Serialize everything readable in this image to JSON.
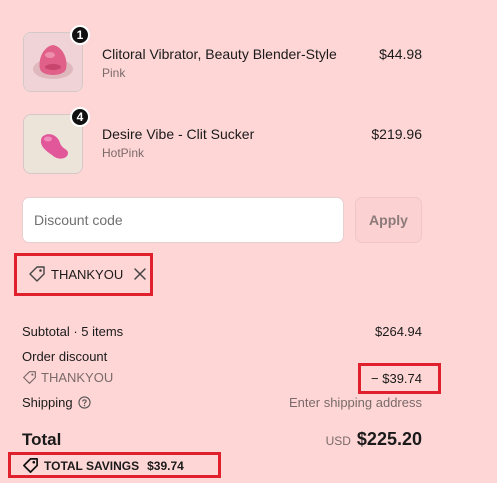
{
  "line_items": [
    {
      "name": "Clitoral Vibrator, Beauty Blender-Style",
      "variant": "Pink",
      "price": "$44.98",
      "quantity": "1",
      "image_icon": "pink-egg-product-image",
      "image_color": "#e0608a"
    },
    {
      "name": "Desire Vibe - Clit Sucker",
      "variant": "HotPink",
      "price": "$219.96",
      "quantity": "4",
      "image_icon": "pink-curved-product-image",
      "image_color": "#e2579a"
    }
  ],
  "discount": {
    "placeholder": "Discount code",
    "apply_label": "Apply",
    "applied_code": "THANKYOU"
  },
  "summary": {
    "subtotal_label": "Subtotal · 5 items",
    "subtotal_value": "$264.94",
    "order_discount_label": "Order discount",
    "order_discount_code": "THANKYOU",
    "order_discount_value": "− $39.74",
    "shipping_label": "Shipping",
    "shipping_value": "Enter shipping address",
    "total_label": "Total",
    "currency": "USD",
    "total_value": "$225.20",
    "savings_label": "TOTAL SAVINGS",
    "savings_value": "$39.74"
  },
  "colors": {
    "background": "#ffd6d6",
    "highlight": "#e0202c",
    "apply_button": "#fbd1d1"
  }
}
